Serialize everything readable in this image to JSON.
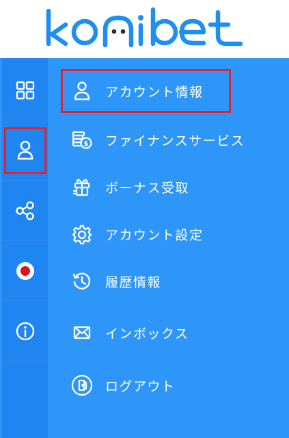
{
  "brand": {
    "logo_text": "konibet"
  },
  "rail": {
    "items": [
      {
        "icon": "dashboard-grid-icon"
      },
      {
        "icon": "user-icon",
        "selected": true
      },
      {
        "icon": "share-icon"
      },
      {
        "icon": "japan-flag-icon"
      },
      {
        "icon": "info-icon"
      }
    ]
  },
  "menu": {
    "items": [
      {
        "label": "アカウント情報",
        "icon": "user-icon",
        "selected": true
      },
      {
        "label": "ファイナンスサービス",
        "icon": "finance-coins-icon"
      },
      {
        "label": "ボーナス受取",
        "icon": "gift-icon"
      },
      {
        "label": "アカウント設定",
        "icon": "gear-icon"
      },
      {
        "label": "履歴情報",
        "icon": "history-icon"
      },
      {
        "label": "インボックス",
        "icon": "mail-icon"
      },
      {
        "label": "ログアウト",
        "icon": "logout-icon"
      }
    ]
  },
  "colors": {
    "panel": "#2e96f8",
    "rail": "#1f85f0",
    "logo": "#1f8ef1",
    "highlight": "#e8212f"
  }
}
